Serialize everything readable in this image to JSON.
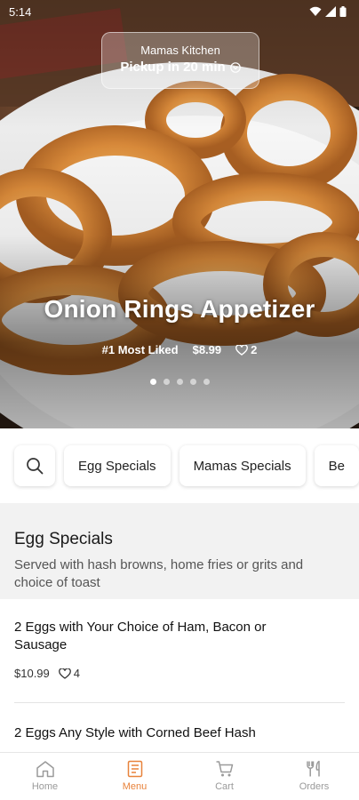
{
  "status_bar": {
    "time": "5:14"
  },
  "pickup": {
    "restaurant": "Mamas Kitchen",
    "pickup_text": "Pickup in 20 min"
  },
  "featured": {
    "title": "Onion Rings Appetizer",
    "badge": "#1 Most Liked",
    "price": "$8.99",
    "likes": "2",
    "carousel_dots": 5,
    "active_dot": 0
  },
  "categories": [
    "Egg Specials",
    "Mamas Specials",
    "Be"
  ],
  "section": {
    "title": "Egg Specials",
    "description": "Served with hash browns, home fries or grits and choice of toast"
  },
  "items": [
    {
      "name": "2 Eggs with Your Choice of Ham, Bacon or Sausage",
      "price": "$10.99",
      "likes": "4"
    },
    {
      "name": "2 Eggs Any Style with Corned Beef Hash"
    }
  ],
  "nav": [
    {
      "label": "Home",
      "icon": "home-icon"
    },
    {
      "label": "Menu",
      "icon": "menu-icon",
      "active": true
    },
    {
      "label": "Cart",
      "icon": "cart-icon"
    },
    {
      "label": "Orders",
      "icon": "orders-icon"
    }
  ],
  "colors": {
    "accent": "#e8823a"
  }
}
